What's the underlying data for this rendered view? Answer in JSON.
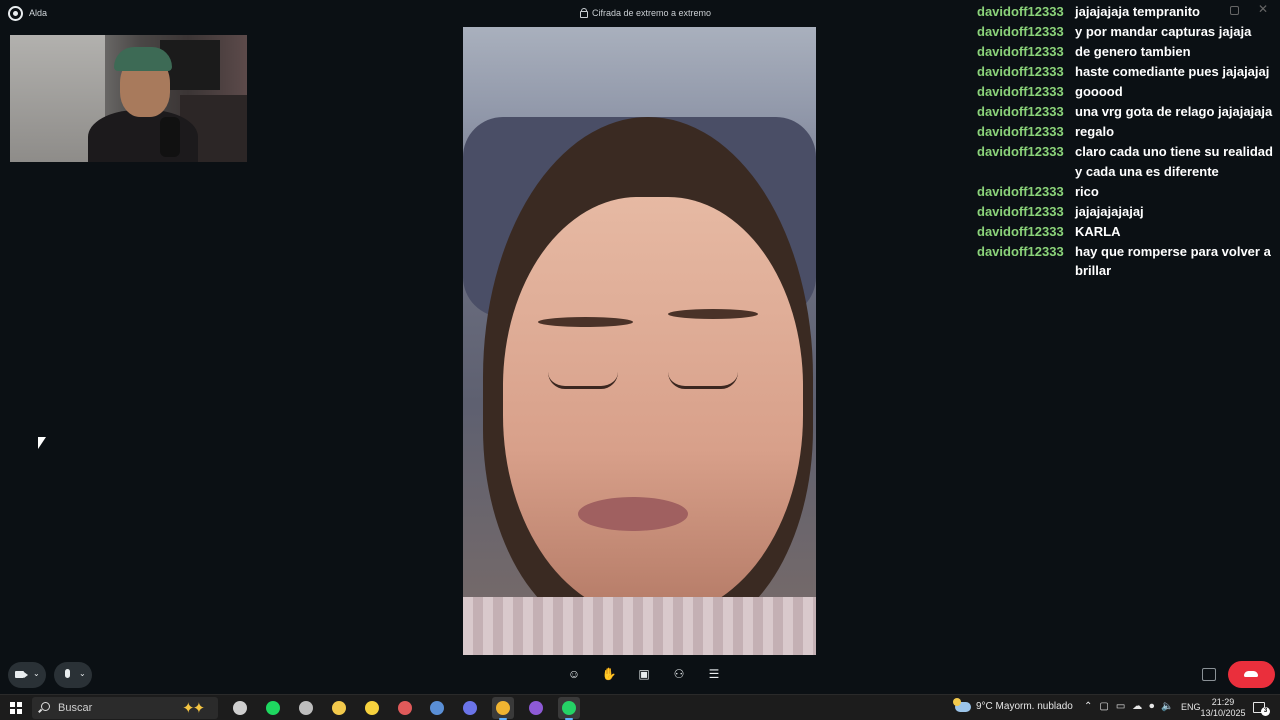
{
  "window": {
    "app_name": "Alda",
    "encryption_label": "Cifrada de extremo a extremo"
  },
  "chat": [
    {
      "user": "davidoff12333",
      "msg": "jajajajaja tempranito"
    },
    {
      "user": "davidoff12333",
      "msg": "y por mandar capturas jajaja"
    },
    {
      "user": "davidoff12333",
      "msg": "de genero tambien"
    },
    {
      "user": "davidoff12333",
      "msg": "haste comediante pues jajajajaj"
    },
    {
      "user": "davidoff12333",
      "msg": "gooood"
    },
    {
      "user": "davidoff12333",
      "msg": "una vrg gota de relago jajajajaja"
    },
    {
      "user": "davidoff12333",
      "msg": "regalo"
    },
    {
      "user": "davidoff12333",
      "msg": "claro cada uno tiene su realidad y cada una es diferente"
    },
    {
      "user": "davidoff12333",
      "msg": "rico"
    },
    {
      "user": "davidoff12333",
      "msg": "jajajajajajaj"
    },
    {
      "user": "davidoff12333",
      "msg": "KARLA"
    },
    {
      "user": "davidoff12333",
      "msg": "hay que romperse para volver a brillar"
    }
  ],
  "call_controls": {
    "icons": [
      "emoji-icon",
      "raise-hand-icon",
      "screen-share-icon",
      "add-person-icon",
      "captions-icon"
    ]
  },
  "taskbar": {
    "search_placeholder": "Buscar",
    "weather": "9°C  Mayorm. nublado",
    "language": "ENG",
    "time": "21:29",
    "date": "13/10/2025",
    "notification_count": "3",
    "apps": [
      {
        "name": "task-view",
        "color": "#cfcfcf"
      },
      {
        "name": "spotify",
        "color": "#1ed760"
      },
      {
        "name": "obs",
        "color": "#bdbdbd"
      },
      {
        "name": "file-explorer",
        "color": "#f2c94c"
      },
      {
        "name": "sticky-notes",
        "color": "#f7d23e"
      },
      {
        "name": "app-red",
        "color": "#e05a5a"
      },
      {
        "name": "steam",
        "color": "#5a8fd6"
      },
      {
        "name": "discord",
        "color": "#6b74e8"
      },
      {
        "name": "chrome",
        "color": "#f0b431"
      },
      {
        "name": "app-purple",
        "color": "#8e5ad6"
      },
      {
        "name": "whatsapp",
        "color": "#25d366"
      }
    ]
  },
  "colors": {
    "chat_user": "#8bd37a",
    "end_call": "#ea2f3c"
  }
}
